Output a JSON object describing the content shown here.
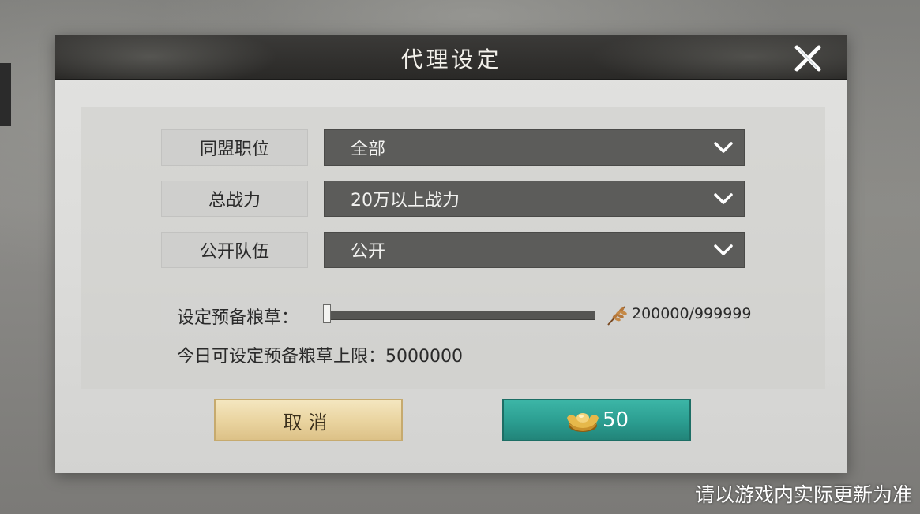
{
  "dialog": {
    "title": "代理设定"
  },
  "fields": [
    {
      "label": "同盟职位",
      "value": "全部"
    },
    {
      "label": "总战力",
      "value": "20万以上战力"
    },
    {
      "label": "公开队伍",
      "value": "公开"
    }
  ],
  "reserve": {
    "label": "设定预备粮草：",
    "value_text": "200000/999999",
    "limit_text": "今日可设定预备粮草上限：5000000"
  },
  "buttons": {
    "cancel_label": "取消",
    "confirm_cost": "50"
  },
  "icons": {
    "close": "close-icon",
    "dropdown": "chevron-down-icon",
    "grain": "grain-icon",
    "ingot": "gold-ingot-icon"
  },
  "colors": {
    "confirm_button": "#2b9d90",
    "cancel_button": "#e9d39e",
    "select_bg": "#5c5c5a"
  },
  "footnote": "请以游戏内实际更新为准"
}
